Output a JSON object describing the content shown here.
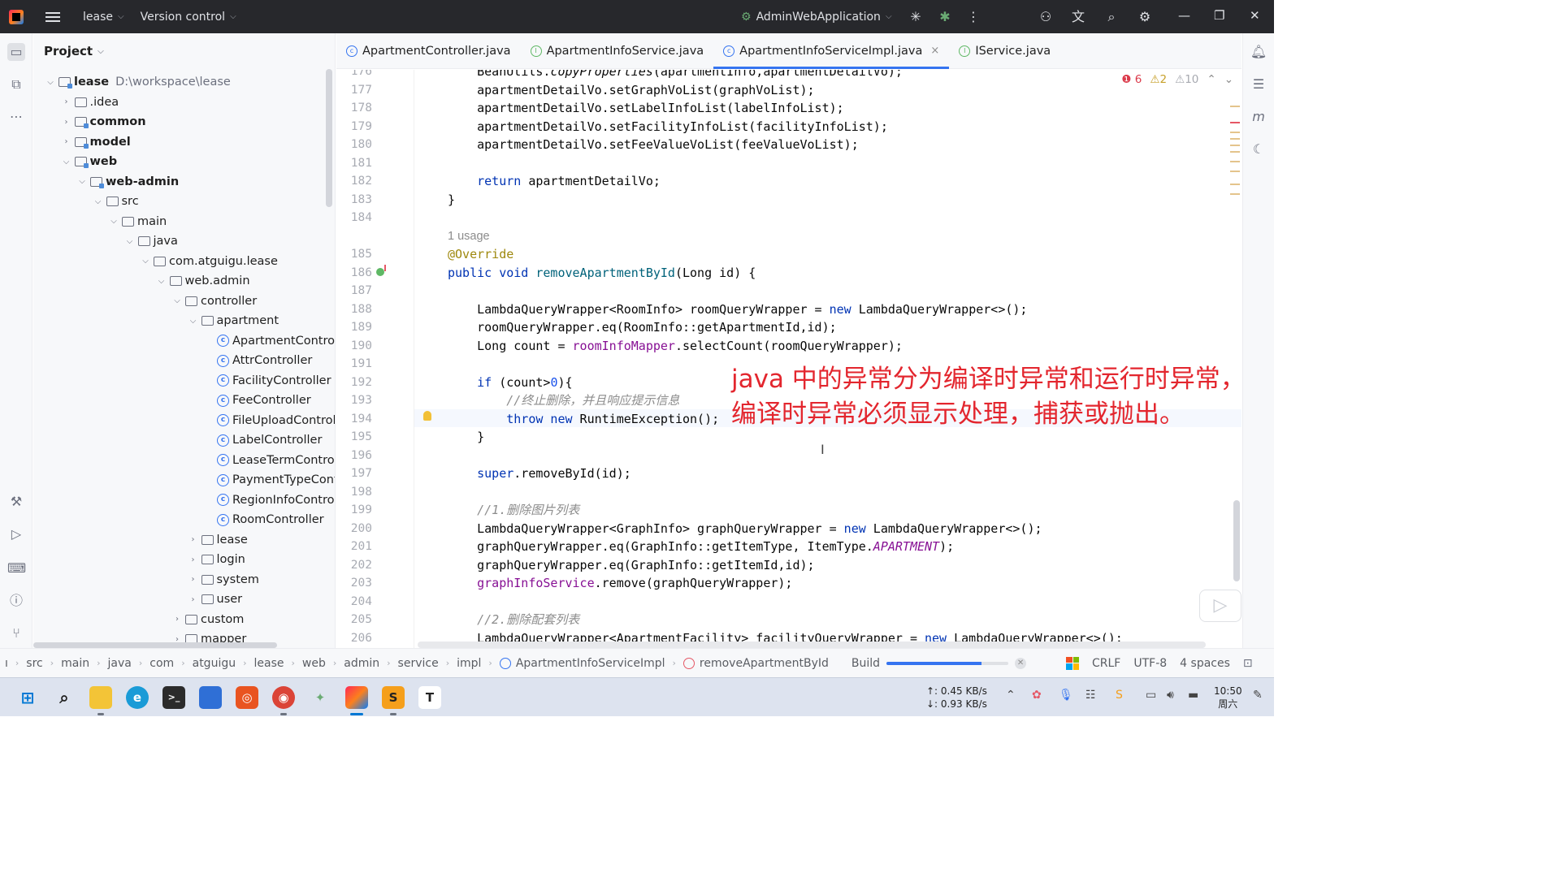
{
  "titlebar": {
    "project_name": "lease",
    "vcs_label": "Version control",
    "run_config": "AdminWebApplication"
  },
  "project_panel": {
    "title": "Project",
    "tree": [
      {
        "label": "lease",
        "path": "D:\\workspace\\lease",
        "indent": 0,
        "expanded": true,
        "kind": "module",
        "bold": true
      },
      {
        "label": ".idea",
        "indent": 1,
        "expanded": false,
        "kind": "folder"
      },
      {
        "label": "common",
        "indent": 1,
        "expanded": false,
        "kind": "module",
        "bold": true
      },
      {
        "label": "model",
        "indent": 1,
        "expanded": false,
        "kind": "module",
        "bold": true
      },
      {
        "label": "web",
        "indent": 1,
        "expanded": true,
        "kind": "module",
        "bold": true
      },
      {
        "label": "web-admin",
        "indent": 2,
        "expanded": true,
        "kind": "module",
        "bold": true
      },
      {
        "label": "src",
        "indent": 3,
        "expanded": true,
        "kind": "folder"
      },
      {
        "label": "main",
        "indent": 4,
        "expanded": true,
        "kind": "folder"
      },
      {
        "label": "java",
        "indent": 5,
        "expanded": true,
        "kind": "source"
      },
      {
        "label": "com.atguigu.lease",
        "indent": 6,
        "expanded": true,
        "kind": "package"
      },
      {
        "label": "web.admin",
        "indent": 7,
        "expanded": true,
        "kind": "package"
      },
      {
        "label": "controller",
        "indent": 8,
        "expanded": true,
        "kind": "package"
      },
      {
        "label": "apartment",
        "indent": 9,
        "expanded": true,
        "kind": "package"
      },
      {
        "label": "ApartmentControll",
        "indent": 10,
        "kind": "class"
      },
      {
        "label": "AttrController",
        "indent": 10,
        "kind": "class"
      },
      {
        "label": "FacilityController",
        "indent": 10,
        "kind": "class"
      },
      {
        "label": "FeeController",
        "indent": 10,
        "kind": "class"
      },
      {
        "label": "FileUploadControll",
        "indent": 10,
        "kind": "class"
      },
      {
        "label": "LabelController",
        "indent": 10,
        "kind": "class"
      },
      {
        "label": "LeaseTermControl",
        "indent": 10,
        "kind": "class"
      },
      {
        "label": "PaymentTypeCont",
        "indent": 10,
        "kind": "class"
      },
      {
        "label": "RegionInfoControll",
        "indent": 10,
        "kind": "class"
      },
      {
        "label": "RoomController",
        "indent": 10,
        "kind": "class"
      },
      {
        "label": "lease",
        "indent": 9,
        "expanded": false,
        "kind": "package"
      },
      {
        "label": "login",
        "indent": 9,
        "expanded": false,
        "kind": "package"
      },
      {
        "label": "system",
        "indent": 9,
        "expanded": false,
        "kind": "package"
      },
      {
        "label": "user",
        "indent": 9,
        "expanded": false,
        "kind": "package"
      },
      {
        "label": "custom",
        "indent": 8,
        "expanded": false,
        "kind": "package"
      },
      {
        "label": "mapper",
        "indent": 8,
        "expanded": false,
        "kind": "package"
      }
    ]
  },
  "tabs": [
    {
      "label": "ApartmentController.java",
      "icon": "class-icon",
      "active": false
    },
    {
      "label": "ApartmentInfoService.java",
      "icon": "interface-icon",
      "active": false
    },
    {
      "label": "ApartmentInfoServiceImpl.java",
      "icon": "class-icon",
      "active": true
    },
    {
      "label": "IService.java",
      "icon": "interface-icon",
      "active": false
    }
  ],
  "inspections": {
    "errors": "6",
    "warnings": "2",
    "weak_warnings": "10"
  },
  "editor": {
    "usage_hint": "1 usage",
    "lines": [
      {
        "n": "176",
        "html": "        <span>BeanUtils.</span><span class='ital'>copyProperties</span><span>(apartmentInfo,apartmentDetailVo);</span>"
      },
      {
        "n": "177",
        "html": "        apartmentDetailVo.setGraphVoList(graphVoList);"
      },
      {
        "n": "178",
        "html": "        apartmentDetailVo.setLabelInfoList(labelInfoList);"
      },
      {
        "n": "179",
        "html": "        apartmentDetailVo.setFacilityInfoList(facilityInfoList);"
      },
      {
        "n": "180",
        "html": "        apartmentDetailVo.setFeeValueVoList(feeValueVoList);"
      },
      {
        "n": "181",
        "html": ""
      },
      {
        "n": "182",
        "html": "        <span class='kw'>return</span> apartmentDetailVo;"
      },
      {
        "n": "183",
        "html": "    }"
      },
      {
        "n": "184",
        "html": ""
      },
      {
        "n": "185",
        "html": "    <span class='ann'>@Override</span>"
      },
      {
        "n": "186",
        "html": "    <span class='kw'>public void</span> <span style='color:#00627a'>removeApartmentById</span>(Long id) {"
      },
      {
        "n": "187",
        "html": ""
      },
      {
        "n": "188",
        "html": "        LambdaQueryWrapper&lt;RoomInfo&gt; roomQueryWrapper = <span class='kw'>new</span> LambdaQueryWrapper&lt;&gt;();"
      },
      {
        "n": "189",
        "html": "        roomQueryWrapper.eq(RoomInfo::getApartmentId,id);"
      },
      {
        "n": "190",
        "html": "        Long count = <span class='fld'>roomInfoMapper</span>.selectCount(roomQueryWrapper);"
      },
      {
        "n": "191",
        "html": ""
      },
      {
        "n": "192",
        "html": "        <span class='kw'>if</span> (count&gt;<span class='num'>0</span>){"
      },
      {
        "n": "193",
        "html": "            <span class='cmt'>//终止删除，并且响应提示信息</span>"
      },
      {
        "n": "194",
        "html": "            <span class='kw'>throw new</span> RuntimeException();"
      },
      {
        "n": "195",
        "html": "        }"
      },
      {
        "n": "196",
        "html": ""
      },
      {
        "n": "197",
        "html": "        <span class='kw'>super</span>.removeById(id);"
      },
      {
        "n": "198",
        "html": ""
      },
      {
        "n": "199",
        "html": "        <span class='cmt'>//1.删除图片列表</span>"
      },
      {
        "n": "200",
        "html": "        LambdaQueryWrapper&lt;GraphInfo&gt; graphQueryWrapper = <span class='kw'>new</span> LambdaQueryWrapper&lt;&gt;();"
      },
      {
        "n": "201",
        "html": "        graphQueryWrapper.eq(GraphInfo::getItemType, ItemType.<span class='stat'>APARTMENT</span>);"
      },
      {
        "n": "202",
        "html": "        graphQueryWrapper.eq(GraphInfo::getItemId,id);"
      },
      {
        "n": "203",
        "html": "        <span class='fld'>graphInfoService</span>.remove(graphQueryWrapper);"
      },
      {
        "n": "204",
        "html": ""
      },
      {
        "n": "205",
        "html": "        <span class='cmt'>//2.删除配套列表</span>"
      },
      {
        "n": "206",
        "html": "        LambdaQueryWrapper&lt;ApartmentFacility&gt; facilityQueryWrapper = <span class='kw'>new</span> LambdaQueryWrapper&lt;&gt;();"
      }
    ],
    "overlay_lines": [
      "java 中的异常分为编译时异常和运行时异常，",
      "编译时异常必须显示处理，捕获或抛出。"
    ]
  },
  "statusbar": {
    "breadcrumbs": [
      "ı",
      "src",
      "main",
      "java",
      "com",
      "atguigu",
      "lease",
      "web",
      "admin",
      "service",
      "impl",
      "ApartmentInfoServiceImpl",
      "removeApartmentById"
    ],
    "build_label": "Build",
    "build_progress": 0.78,
    "line_separator": "CRLF",
    "encoding": "UTF-8",
    "indent": "4 spaces"
  },
  "taskbar": {
    "net_up": "↑: 0.45 KB/s",
    "net_down": "↓: 0.93 KB/s",
    "time": "10:50",
    "weekday": "周六"
  },
  "colors": {
    "accent": "#3574f0",
    "titlebar_bg": "#27282c",
    "overlay_text": "#e3262e",
    "keyword": "#0033b3"
  }
}
